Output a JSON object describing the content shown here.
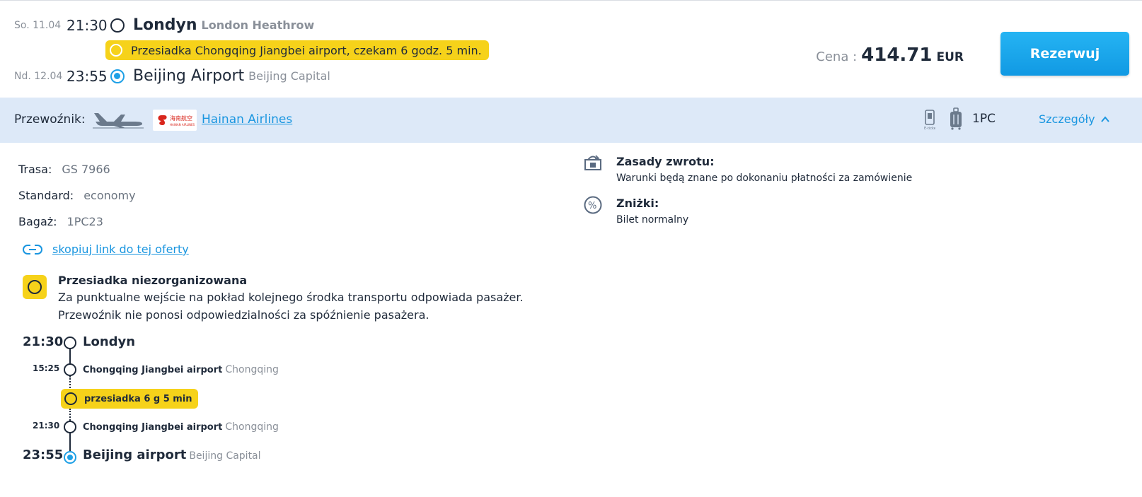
{
  "header": {
    "departure": {
      "date": "So. 11.04",
      "time": "21:30",
      "city": "Londyn",
      "airport": "London Heathrow"
    },
    "transfer_note": "Przesiadka Chongqing Jiangbei airport, czekam 6 godz. 5 min.",
    "arrival": {
      "date": "Nd. 12.04",
      "time": "23:55",
      "city": "Beijing Airport",
      "airport": "Beijing Capital"
    },
    "price_label": "Cena :",
    "price_value": "414.71",
    "currency": "EUR",
    "book_label": "Rezerwuj"
  },
  "carrier": {
    "label": "Przewoźnik:",
    "airline_name": "Hainan Airlines",
    "logo_text": "海南航空",
    "logo_subtext": "HAINAN AIRLINES",
    "baggage": "1PC",
    "details_label": "Szczegóły"
  },
  "details": {
    "route_label": "Trasa:",
    "route_value": "GS 7966",
    "class_label": "Standard:",
    "class_value": "economy",
    "baggage_label": "Bagaż:",
    "baggage_value": "1PC23",
    "copy_link": "skopiuj link do tej oferty",
    "warning_title": "Przesiadka niezorganizowana",
    "warning_line1": "Za punktualne wejście na pokład kolejnego środka transportu odpowiada pasażer.",
    "warning_line2": "Przewoźnik nie ponosi odpowiedzialności za spóźnienie pasażera."
  },
  "timeline": {
    "start_time": "21:30",
    "start_city": "Londyn",
    "arr1_time": "15:25",
    "arr1_airport": "Chongqing Jiangbei airport",
    "arr1_city": "Chongqing",
    "transfer_label": "przesiadka 6 g 5 min",
    "dep2_time": "21:30",
    "dep2_airport": "Chongqing Jiangbei airport",
    "dep2_city": "Chongqing",
    "end_time": "23:55",
    "end_airport": "Beijing airport",
    "end_city": "Beijing Capital"
  },
  "policies": {
    "refund_title": "Zasady zwrotu:",
    "refund_text": "Warunki będą znane po dokonaniu płatności za zamówienie",
    "discount_title": "Zniżki:",
    "discount_text": "Bilet normalny"
  },
  "colors": {
    "accent": "#1a96e0",
    "highlight": "#f6d21a",
    "bar": "#dde9f8",
    "text": "#1f2a3a"
  }
}
